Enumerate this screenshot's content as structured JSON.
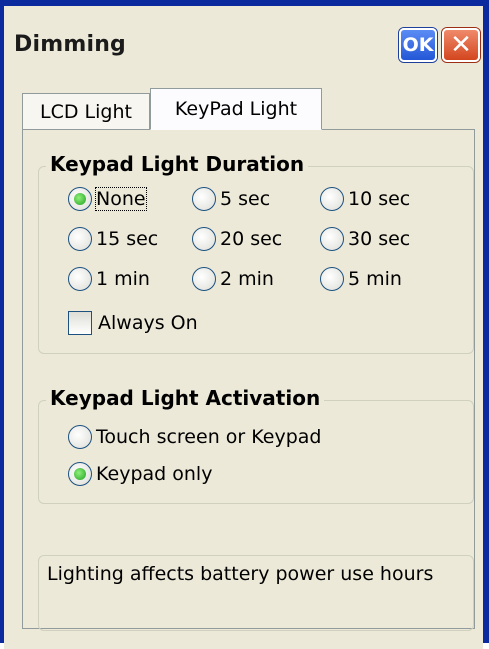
{
  "window": {
    "title": "Dimming",
    "ok_label": "OK",
    "close_label": "✕"
  },
  "tabs": [
    {
      "label": "LCD Light",
      "active": false
    },
    {
      "label": "KeyPad Light",
      "active": true
    }
  ],
  "duration_group": {
    "title": "Keypad Light Duration",
    "options": [
      {
        "label": "None",
        "selected": true
      },
      {
        "label": "5 sec",
        "selected": false
      },
      {
        "label": "10 sec",
        "selected": false
      },
      {
        "label": "15 sec",
        "selected": false
      },
      {
        "label": "20 sec",
        "selected": false
      },
      {
        "label": "30 sec",
        "selected": false
      },
      {
        "label": "1 min",
        "selected": false
      },
      {
        "label": "2 min",
        "selected": false
      },
      {
        "label": "5 min",
        "selected": false
      }
    ],
    "always_on": {
      "label": "Always On",
      "checked": false
    }
  },
  "activation_group": {
    "title": "Keypad Light Activation",
    "options": [
      {
        "label": "Touch screen or Keypad",
        "selected": false
      },
      {
        "label": "Keypad only",
        "selected": true
      }
    ]
  },
  "info_text": "Lighting affects battery power use hours"
}
